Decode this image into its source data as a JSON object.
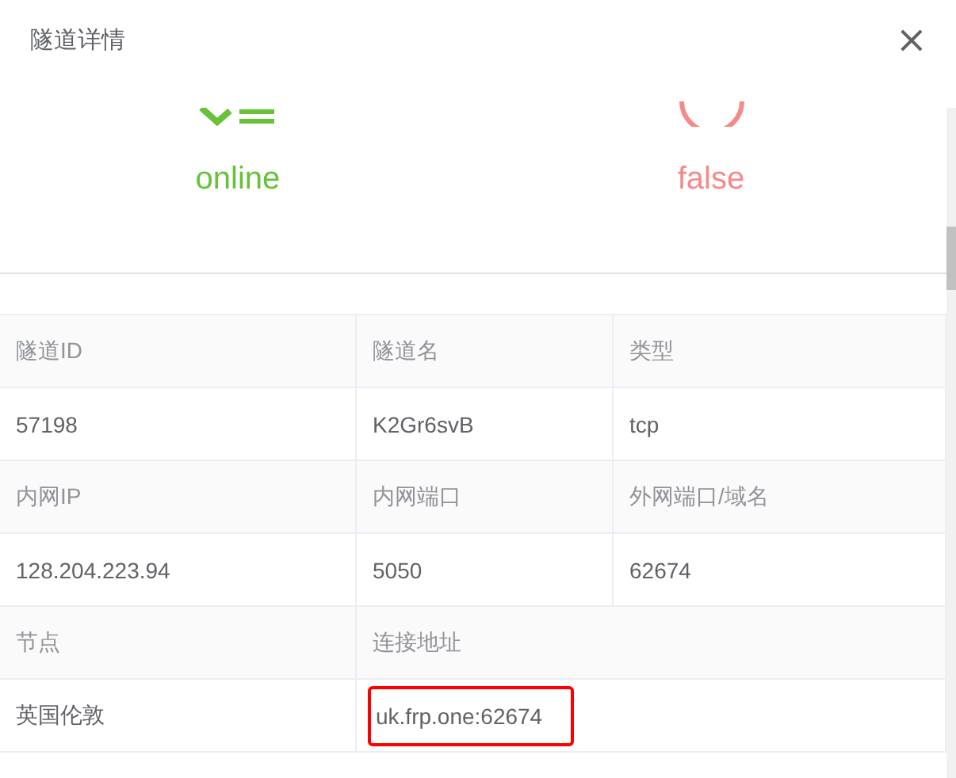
{
  "dialog": {
    "title": "隧道详情",
    "close": "×"
  },
  "statuses": [
    {
      "kind": "success",
      "label": "online"
    },
    {
      "kind": "failure",
      "label": "false"
    }
  ],
  "table": {
    "rows": [
      {
        "kind": "label",
        "cells": [
          {
            "text": "隧道ID",
            "highlighted": false
          },
          {
            "text": "隧道名",
            "highlighted": false
          },
          {
            "text": "类型",
            "highlighted": false
          }
        ]
      },
      {
        "kind": "value",
        "cells": [
          {
            "text": "57198",
            "highlighted": false
          },
          {
            "text": "K2Gr6svB",
            "highlighted": false
          },
          {
            "text": "tcp",
            "highlighted": false
          }
        ]
      },
      {
        "kind": "label",
        "cells": [
          {
            "text": "内网IP",
            "highlighted": false
          },
          {
            "text": "内网端口",
            "highlighted": false
          },
          {
            "text": "外网端口/域名",
            "highlighted": false
          }
        ]
      },
      {
        "kind": "value",
        "cells": [
          {
            "text": "128.204.223.94",
            "highlighted": false
          },
          {
            "text": "5050",
            "highlighted": false
          },
          {
            "text": "62674",
            "highlighted": false
          }
        ]
      },
      {
        "kind": "label",
        "cells": [
          {
            "text": "节点",
            "highlighted": false
          },
          {
            "text": "连接地址",
            "highlighted": false
          }
        ]
      },
      {
        "kind": "value",
        "cells": [
          {
            "text": "英国伦敦",
            "highlighted": false
          },
          {
            "text": "uk.frp.one:62674",
            "highlighted": true
          }
        ]
      }
    ]
  }
}
